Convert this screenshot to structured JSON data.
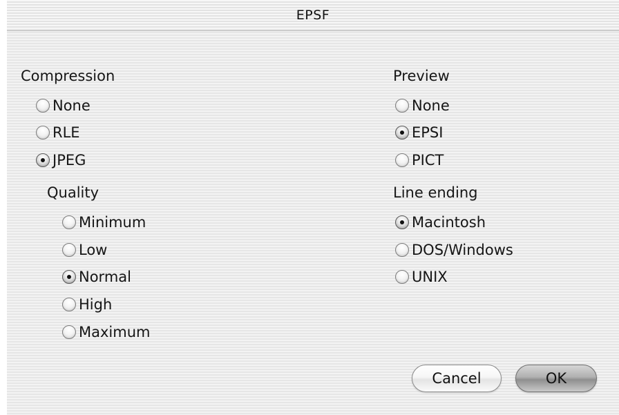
{
  "dialog": {
    "title": "EPSF"
  },
  "compression": {
    "heading": "Compression",
    "options": [
      {
        "label": "None",
        "selected": false
      },
      {
        "label": "RLE",
        "selected": false
      },
      {
        "label": "JPEG",
        "selected": true
      }
    ],
    "quality": {
      "heading": "Quality",
      "options": [
        {
          "label": "Minimum",
          "selected": false
        },
        {
          "label": "Low",
          "selected": false
        },
        {
          "label": "Normal",
          "selected": true
        },
        {
          "label": "High",
          "selected": false
        },
        {
          "label": "Maximum",
          "selected": false
        }
      ]
    }
  },
  "preview": {
    "heading": "Preview",
    "options": [
      {
        "label": "None",
        "selected": false
      },
      {
        "label": "EPSI",
        "selected": true
      },
      {
        "label": "PICT",
        "selected": false
      }
    ]
  },
  "line_ending": {
    "heading": "Line ending",
    "options": [
      {
        "label": "Macintosh",
        "selected": true
      },
      {
        "label": "DOS/Windows",
        "selected": false
      },
      {
        "label": "UNIX",
        "selected": false
      }
    ]
  },
  "buttons": {
    "cancel_label": "Cancel",
    "ok_label": "OK"
  }
}
